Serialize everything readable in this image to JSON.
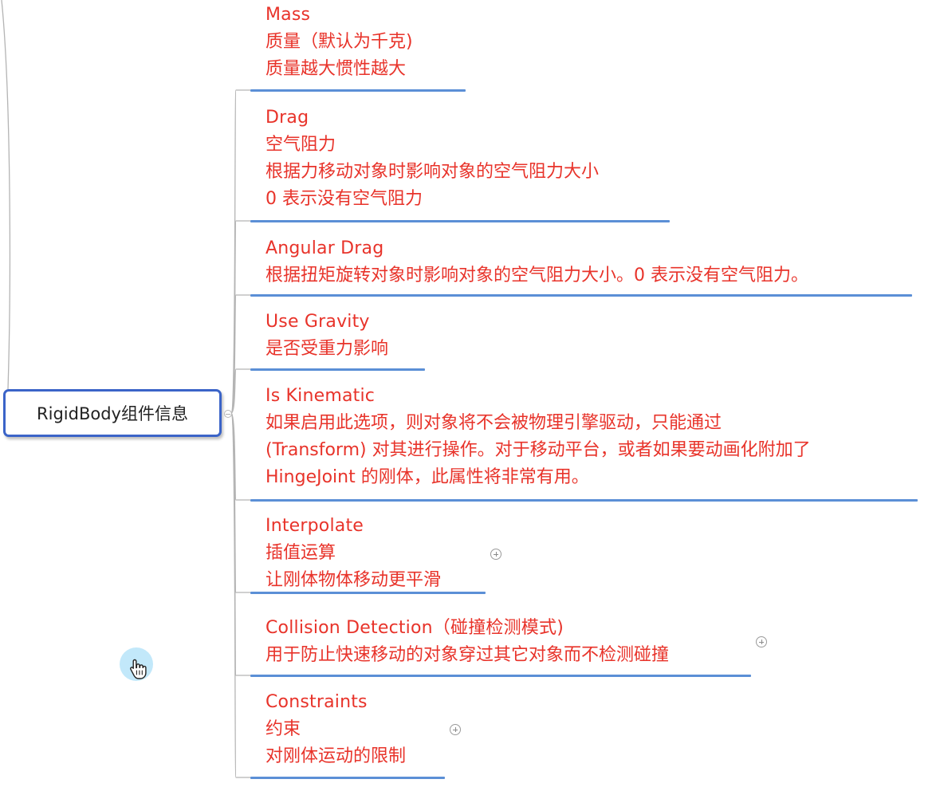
{
  "root": {
    "label": "RigidBody组件信息"
  },
  "colors": {
    "text": "#e8332a",
    "underline": "#5b8fd6",
    "root_border": "#3b64c8",
    "connector": "#b4b4b4"
  },
  "topics": [
    {
      "id": "mass",
      "title": "Mass",
      "lines": [
        "质量（默认为千克)",
        "质量越大惯性越大"
      ],
      "expandable": false
    },
    {
      "id": "drag",
      "title": "Drag",
      "lines": [
        "空气阻力",
        "根据力移动对象时影响对象的空气阻力大小",
        "0 表示没有空气阻力"
      ],
      "expandable": false
    },
    {
      "id": "angular-drag",
      "title": "Angular Drag",
      "lines": [
        "根据扭矩旋转对象时影响对象的空气阻力大小。0 表示没有空气阻力。"
      ],
      "expandable": false
    },
    {
      "id": "use-gravity",
      "title": "Use Gravity",
      "lines": [
        "是否受重力影响"
      ],
      "expandable": false
    },
    {
      "id": "is-kinematic",
      "title": "Is Kinematic",
      "lines": [
        "如果启用此选项，则对象将不会被物理引擎驱动，只能通过",
        "(Transform) 对其进行操作。对于移动平台，或者如果要动画化附加了",
        "HingeJoint 的刚体，此属性将非常有用。"
      ],
      "expandable": false
    },
    {
      "id": "interpolate",
      "title": "Interpolate",
      "lines": [
        "插值运算",
        "让刚体物体移动更平滑"
      ],
      "expandable": true
    },
    {
      "id": "collision-detection",
      "title": "Collision Detection（碰撞检测模式)",
      "lines": [
        "用于防止快速移动的对象穿过其它对象而不检测碰撞"
      ],
      "expandable": true
    },
    {
      "id": "constraints",
      "title": "Constraints",
      "lines": [
        "约束",
        "对刚体运动的限制"
      ],
      "expandable": true
    }
  ],
  "icons": {
    "expand": "plus-circle-icon",
    "collapse": "minus-circle-icon",
    "cursor": "hand-pointer-icon"
  }
}
